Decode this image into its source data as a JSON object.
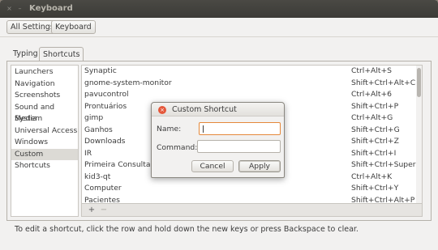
{
  "window": {
    "title": "Keyboard",
    "close_glyph": "×",
    "minimize_glyph": "–"
  },
  "toolbar": {
    "all_settings": "All Settings",
    "current": "Keyboard"
  },
  "tabs": [
    {
      "label": "Typing"
    },
    {
      "label": "Shortcuts"
    }
  ],
  "categories": [
    {
      "label": "Launchers"
    },
    {
      "label": "Navigation"
    },
    {
      "label": "Screenshots"
    },
    {
      "label": "Sound and Media"
    },
    {
      "label": "System"
    },
    {
      "label": "Universal Access"
    },
    {
      "label": "Windows"
    },
    {
      "label": "Custom Shortcuts"
    }
  ],
  "selected_category": "Custom Shortcuts",
  "shortcuts": [
    {
      "name": "Synaptic",
      "accel": "Ctrl+Alt+S"
    },
    {
      "name": "gnome-system-monitor",
      "accel": "Shift+Ctrl+Alt+C"
    },
    {
      "name": "pavucontrol",
      "accel": "Ctrl+Alt+6"
    },
    {
      "name": "Prontuários",
      "accel": "Shift+Ctrl+P"
    },
    {
      "name": "gimp",
      "accel": "Ctrl+Alt+G"
    },
    {
      "name": "Ganhos",
      "accel": "Shift+Ctrl+G"
    },
    {
      "name": "Downloads",
      "accel": "Shift+Ctrl+Z"
    },
    {
      "name": "IR",
      "accel": "Shift+Ctrl+I"
    },
    {
      "name": "Primeira Consulta",
      "accel": "Shift+Ctrl+Super+P"
    },
    {
      "name": "kid3-qt",
      "accel": "Ctrl+Alt+K"
    },
    {
      "name": "Computer",
      "accel": "Shift+Ctrl+Y"
    },
    {
      "name": "Pacientes",
      "accel": "Shift+Ctrl+Alt+P"
    }
  ],
  "list_toolbar": {
    "add_glyph": "+",
    "remove_glyph": "−"
  },
  "hint": "To edit a shortcut, click the row and hold down the new keys or press Backspace to clear.",
  "dialog": {
    "title": "Custom Shortcut",
    "close_glyph": "×",
    "name_label": "Name:",
    "name_value": "",
    "command_label": "Command:",
    "command_value": "",
    "cancel_label": "Cancel",
    "apply_label": "Apply"
  },
  "colors": {
    "titlebar": "#3c3b37",
    "close_red": "#e5573a",
    "focus_orange": "#e5883a"
  }
}
